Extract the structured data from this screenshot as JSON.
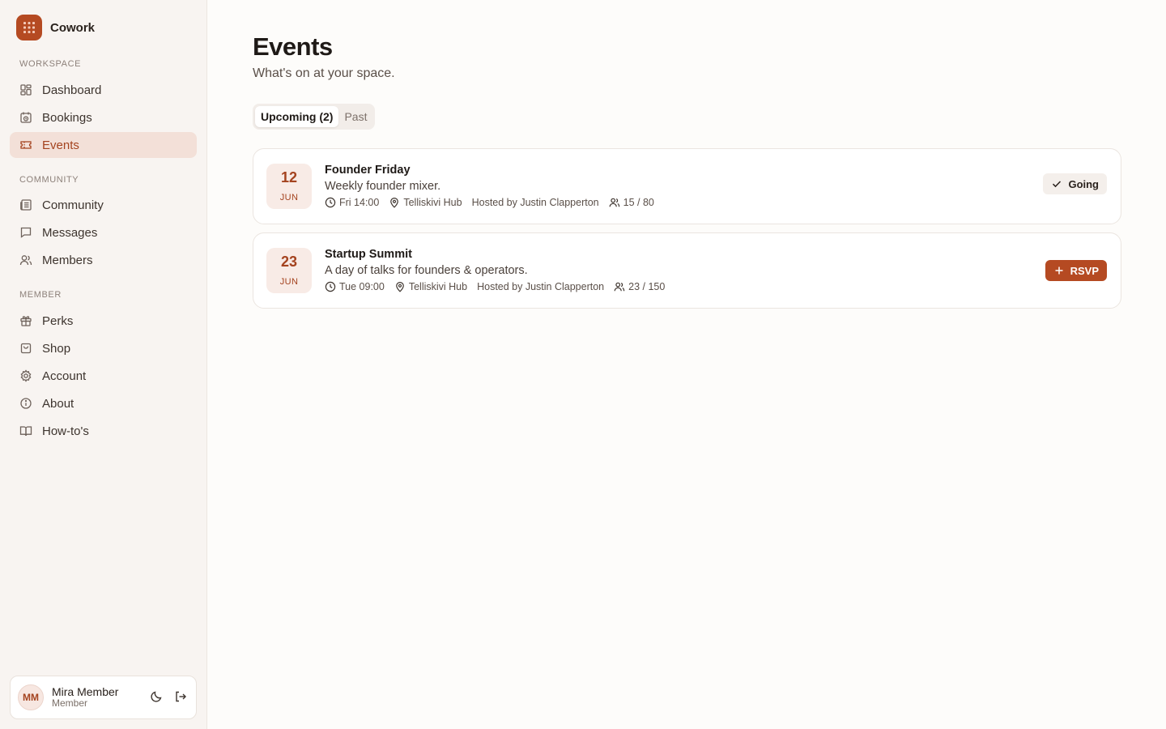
{
  "brand": {
    "name": "Cowork",
    "logo_icon": "grid-dots-icon",
    "accent": "#b54a22"
  },
  "sidebar": {
    "sections": [
      {
        "label": "Workspace"
      },
      {
        "label": "Community"
      },
      {
        "label": "Member"
      }
    ],
    "items": [
      {
        "label": "Dashboard",
        "icon": "dashboard-icon"
      },
      {
        "label": "Bookings",
        "icon": "calendar-clock-icon"
      },
      {
        "label": "Events",
        "icon": "ticket-icon",
        "active": true
      },
      {
        "label": "Community",
        "icon": "newspaper-icon"
      },
      {
        "label": "Messages",
        "icon": "message-icon"
      },
      {
        "label": "Members",
        "icon": "users-icon"
      },
      {
        "label": "Perks",
        "icon": "gift-icon"
      },
      {
        "label": "Shop",
        "icon": "shopping-bag-icon"
      },
      {
        "label": "Account",
        "icon": "gear-icon"
      },
      {
        "label": "About",
        "icon": "info-icon"
      },
      {
        "label": "How-to's",
        "icon": "book-icon"
      }
    ]
  },
  "user": {
    "initials": "MM",
    "name": "Mira Member",
    "role": "Member"
  },
  "main": {
    "title": "Events",
    "subtitle": "What's on at your space.",
    "tabs": [
      {
        "label": "Upcoming (2)",
        "active": true
      },
      {
        "label": "Past",
        "active": false
      }
    ],
    "events": [
      {
        "day": "12",
        "month": "JUN",
        "title": "Founder Friday",
        "description": "Weekly founder mixer.",
        "time": "Fri 14:00",
        "location": "Telliskivi Hub",
        "host": "Hosted by Justin Clapperton",
        "attendance": "15 / 80",
        "action": "Going"
      },
      {
        "day": "23",
        "month": "JUN",
        "title": "Startup Summit",
        "description": "A day of talks for founders & operators.",
        "time": "Tue 09:00",
        "location": "Telliskivi Hub",
        "host": "Hosted by Justin Clapperton",
        "attendance": "23 / 150",
        "action": "RSVP"
      }
    ]
  }
}
